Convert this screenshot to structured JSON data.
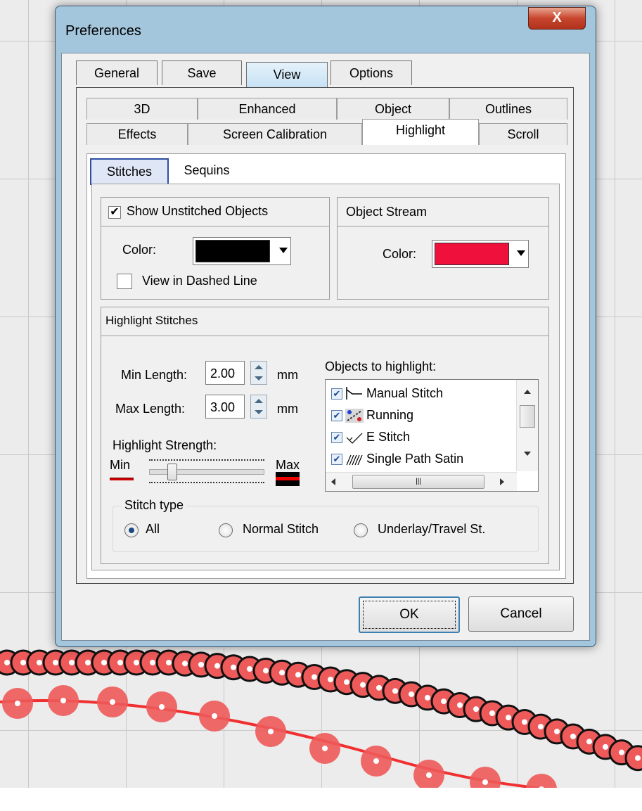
{
  "dialog": {
    "title": "Preferences",
    "close_symbol": "X",
    "main_tabs": [
      "General",
      "Save",
      "View",
      "Options"
    ],
    "active_main_tab": "View",
    "view_tabs_row1": [
      "3D",
      "Enhanced",
      "Object",
      "Outlines"
    ],
    "view_tabs_row2": [
      "Effects",
      "Screen Calibration",
      "Highlight",
      "Scroll"
    ],
    "active_view_tab": "Highlight",
    "highlight_tabs": [
      "Stitches",
      "Sequins"
    ],
    "active_highlight_tab": "Stitches",
    "unstitched": {
      "checkbox_label": "Show Unstitched Objects",
      "checked": true,
      "color_label": "Color:",
      "color": "#000000",
      "dashed_label": "View in Dashed Line",
      "dashed_checked": false
    },
    "object_stream": {
      "title": "Object Stream",
      "color_label": "Color:",
      "color": "#f0103c"
    },
    "highlight_stitches": {
      "title": "Highlight Stitches",
      "min_length_label": "Min Length:",
      "min_length_value": "2.00",
      "max_length_label": "Max Length:",
      "max_length_value": "3.00",
      "unit": "mm",
      "strength_label": "Highlight Strength:",
      "min_label": "Min",
      "max_label": "Max",
      "strength_level": 0.17,
      "objects_label": "Objects to highlight:",
      "objects": [
        {
          "label": "Manual Stitch",
          "checked": true,
          "icon": "manual-stitch-icon"
        },
        {
          "label": "Running",
          "checked": true,
          "icon": "running-stitch-icon"
        },
        {
          "label": "E Stitch",
          "checked": true,
          "icon": "e-stitch-icon"
        },
        {
          "label": "Single Path Satin",
          "checked": true,
          "icon": "single-path-satin-icon"
        }
      ],
      "stitch_type_label": "Stitch type",
      "stitch_types": [
        "All",
        "Normal Stitch",
        "Underlay/Travel St."
      ],
      "selected_stitch_type": "All"
    },
    "ok_label": "OK",
    "cancel_label": "Cancel"
  },
  "colors": {
    "title_bar": "#a4c6dc",
    "close_button": "#c8452d",
    "stitch_fill": "#ee5a5a",
    "stitch_outline": "#111111"
  }
}
